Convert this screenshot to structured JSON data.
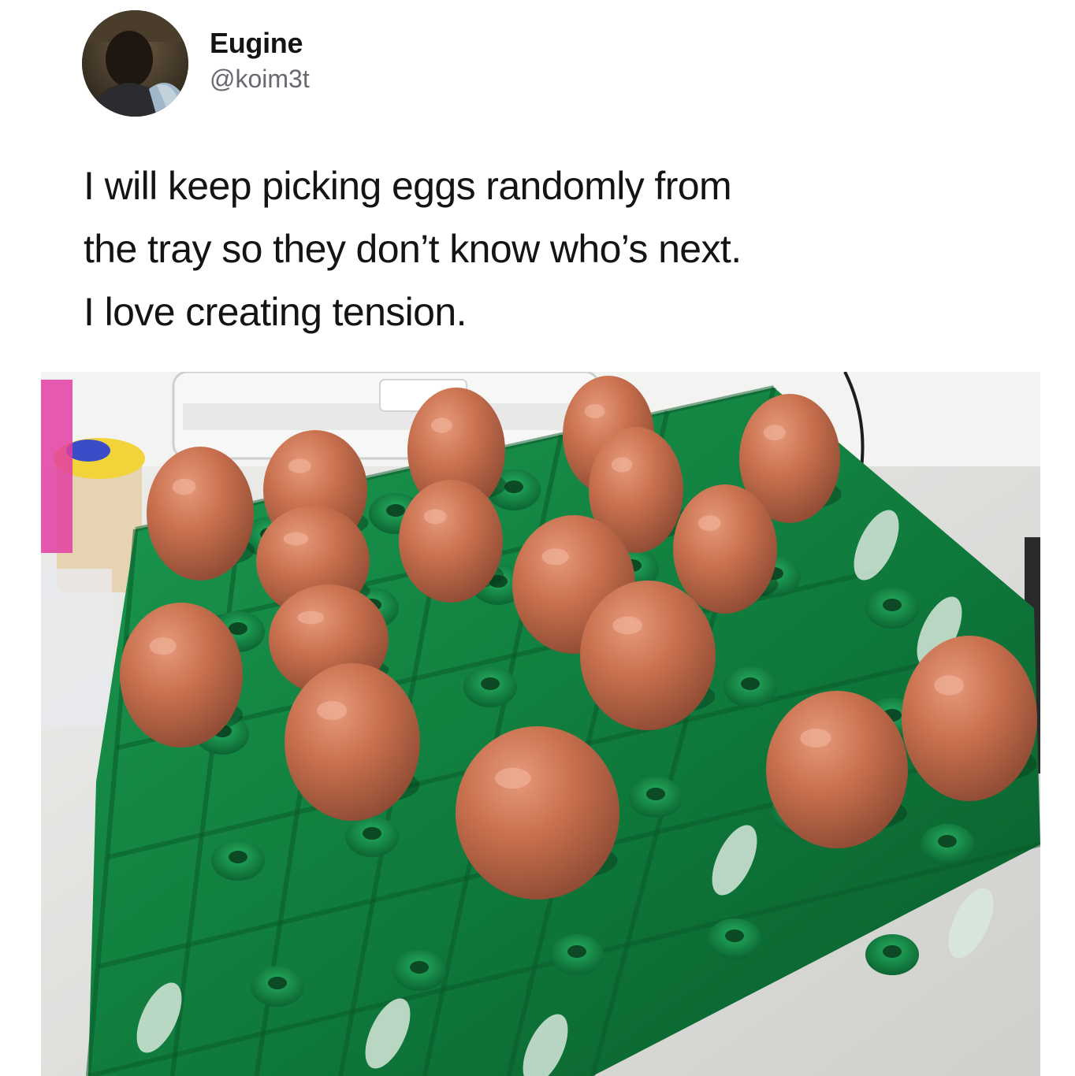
{
  "tweet": {
    "author": {
      "display_name": "Eugine",
      "handle": "@koim3t"
    },
    "text_lines": [
      "I will keep picking eggs randomly from",
      "the tray so they don’t know who’s next.",
      "I love creating tension."
    ],
    "photo": {
      "subject": "brown eggs in a green plastic egg tray",
      "egg_count": 17
    }
  },
  "colors": {
    "text_primary": "#141414",
    "text_secondary": "#666a70",
    "tray_green": "#0f7a3c",
    "egg_brown": "#c06a4b"
  }
}
